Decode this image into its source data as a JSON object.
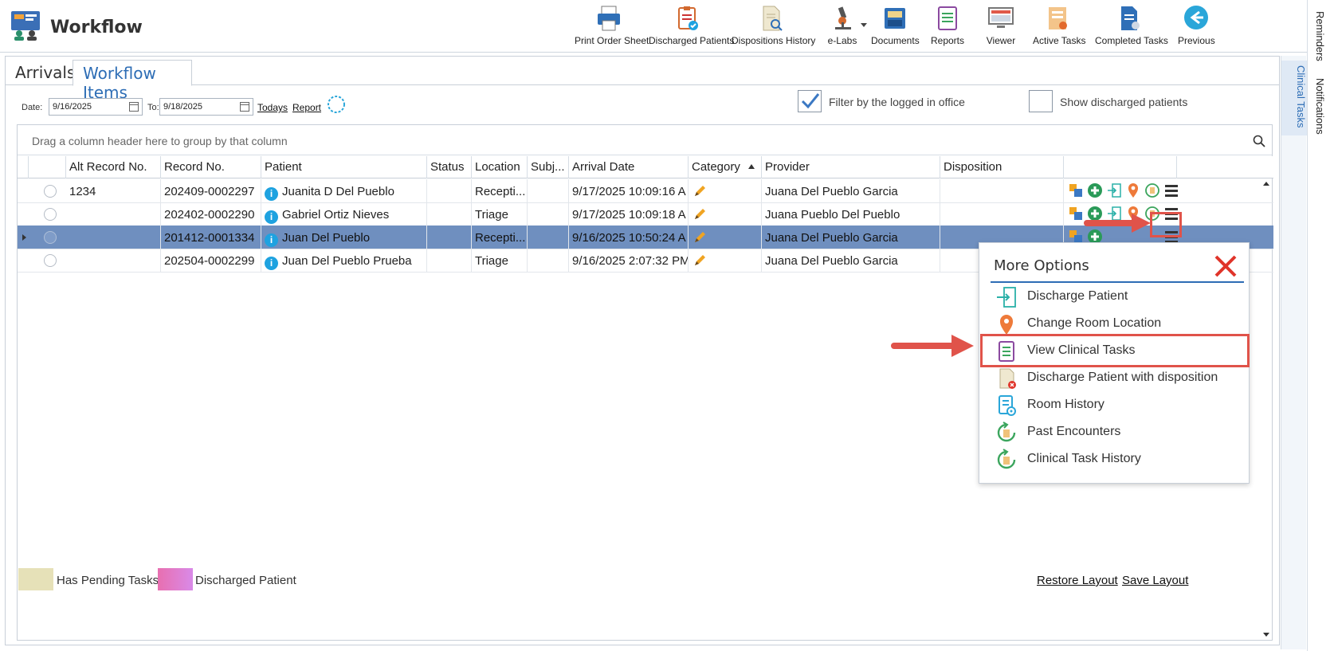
{
  "app": {
    "title": "Workflow"
  },
  "toolbar": [
    {
      "label": "Print Order Sheet",
      "icon": "printer-icon"
    },
    {
      "label": "Discharged Patients",
      "icon": "discharged-clipboard-icon"
    },
    {
      "label": "Dispositions History",
      "icon": "document-search-icon"
    },
    {
      "label": "e-Labs",
      "icon": "microscope-icon"
    },
    {
      "label": "Documents",
      "icon": "folder-drawer-icon"
    },
    {
      "label": "Reports",
      "icon": "reports-icon"
    },
    {
      "label": "Viewer",
      "icon": "monitor-icon"
    },
    {
      "label": "Active Tasks",
      "icon": "active-tasks-icon"
    },
    {
      "label": "Completed Tasks",
      "icon": "completed-tasks-icon"
    },
    {
      "label": "Previous",
      "icon": "back-arrow-icon"
    }
  ],
  "side_tabs": {
    "reminders": "Reminders",
    "notifications": "Notifications",
    "clinical_tasks": "Clinical Tasks"
  },
  "tabs": {
    "arrivals": "Arrivals",
    "workflow_items": "Workflow Items"
  },
  "filters": {
    "date_label": "Date:",
    "date_from": "9/16/2025",
    "to_label": "To:",
    "date_to": "9/18/2025",
    "todays": "Todays",
    "report": "Report",
    "filter_logged": "Filter by the logged in office",
    "filter_logged_checked": true,
    "show_discharged": "Show discharged patients",
    "show_discharged_checked": false
  },
  "grid": {
    "group_hint": "Drag a column header here to group by that column",
    "columns": [
      "Alt Record No.",
      "Record No.",
      "Patient",
      "Status",
      "Location",
      "Subj...",
      "Arrival Date",
      "Category",
      "Provider",
      "Disposition"
    ],
    "rows": [
      {
        "alt": "1234",
        "record": "202409-0002297",
        "patient": "Juanita D Del Pueblo",
        "status": "",
        "location": "Recepti...",
        "subj": "",
        "arrival": "9/17/2025 10:09:16 A",
        "provider": "Juana Del Pueblo Garcia",
        "disposition": ""
      },
      {
        "alt": "",
        "record": "202402-0002290",
        "patient": "Gabriel Ortiz Nieves",
        "status": "",
        "location": "Triage",
        "subj": "",
        "arrival": "9/17/2025 10:09:18 A",
        "provider": "Juana Pueblo Del Pueblo",
        "disposition": ""
      },
      {
        "alt": "",
        "record": "201412-0001334",
        "patient": "Juan Del Pueblo",
        "status": "",
        "location": "Recepti...",
        "subj": "",
        "arrival": "9/16/2025 10:50:24 A",
        "provider": "Juana Del Pueblo Garcia",
        "disposition": ""
      },
      {
        "alt": "",
        "record": "202504-0002299",
        "patient": "Juan Del Pueblo Prueba",
        "status": "",
        "location": "Triage",
        "subj": "",
        "arrival": "9/16/2025 2:07:32 PM",
        "provider": "Juana Del Pueblo Garcia",
        "disposition": ""
      }
    ]
  },
  "legend": {
    "pending": "Has Pending Tasks",
    "pending_color": "#e6e1b8",
    "discharged": "Discharged Patient",
    "discharged_color": "#e86fb0",
    "restore": "Restore Layout",
    "save": "Save Layout"
  },
  "more_options": {
    "title": "More Options",
    "items": [
      {
        "label": "Discharge Patient",
        "icon": "discharge-icon"
      },
      {
        "label": "Change Room Location",
        "icon": "location-pin-icon"
      },
      {
        "label": "View Clinical Tasks",
        "icon": "clinical-tasks-icon"
      },
      {
        "label": "Discharge Patient with disposition",
        "icon": "discharge-disposition-icon"
      },
      {
        "label": "Room History",
        "icon": "room-history-icon"
      },
      {
        "label": "Past Encounters",
        "icon": "past-encounters-icon"
      },
      {
        "label": "Clinical Task History",
        "icon": "task-history-icon"
      }
    ]
  },
  "colors": {
    "accent": "#2d6db5",
    "selected_row": "#6f8fbf",
    "highlight": "#e0534a"
  }
}
